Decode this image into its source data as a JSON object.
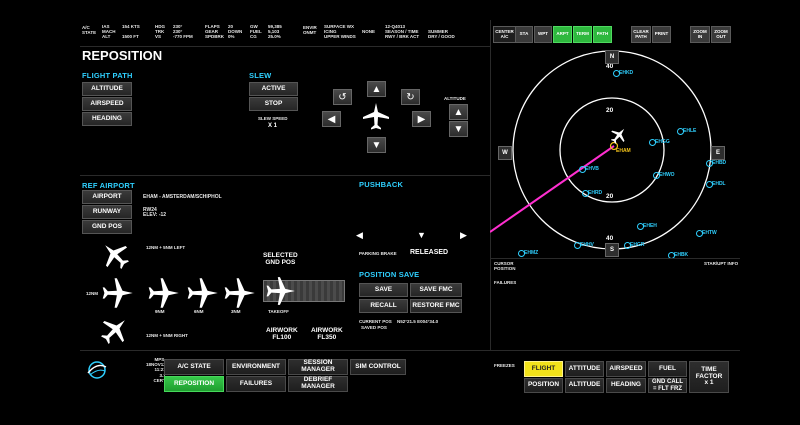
{
  "header": {
    "ac_state": "A/C\nSTATE",
    "c1": {
      "labels": [
        "IAS",
        "MACH",
        "ALT"
      ],
      "values": [
        "154 KTS",
        "",
        "1500 FT"
      ]
    },
    "c2": {
      "labels": [
        "HDG",
        "TRK",
        "VS"
      ],
      "values": [
        "230°",
        "230°",
        "-770 FPM"
      ]
    },
    "c3": {
      "labels": [
        "FLAPS",
        "GEAR",
        "SPDBRK"
      ],
      "values": [
        "20",
        "DOWN",
        "0%"
      ]
    },
    "c4": {
      "labels": [
        "GW",
        "FUEL",
        "CG"
      ],
      "values": [
        "59,385",
        "5,103",
        "25.0%"
      ]
    },
    "envir": "ENVIR\nONMT",
    "c5": {
      "labels": [
        "SURFACE WX",
        "ICING",
        "UPPER WINDS"
      ],
      "values": [
        "",
        "NONE",
        ""
      ]
    },
    "c6": {
      "labels": [
        "12-Q4013",
        "SEASON / TIME",
        "RWY / BRK ACT"
      ],
      "values": [
        "",
        "SUMMER",
        "DRY / GOOD"
      ]
    }
  },
  "page_title": "REPOSITION",
  "flight_path": {
    "title": "FLIGHT PATH",
    "buttons": [
      "ALTITUDE",
      "AIRSPEED",
      "HEADING"
    ]
  },
  "slew": {
    "title": "SLEW",
    "active": "ACTIVE",
    "stop": "STOP",
    "speed_label": "SLEW SPEED",
    "speed_value": "X 1",
    "altitude_label": "ALTITUDE"
  },
  "ref_airport": {
    "title": "REF AIRPORT",
    "buttons": [
      "AIRPORT",
      "RUNWAY",
      "GND POS"
    ],
    "airport_name": "EHAM - AMSTERDAM/SCHIPHOL",
    "runway": "RW24",
    "elev": "ELEV: -12"
  },
  "approach": {
    "left_label": "12NM + 5NM LEFT",
    "right_label": "12NM + 5NM RIGHT",
    "center_label": "12NM",
    "labels": [
      "9NM",
      "6NM",
      "3NM",
      "TAKEOFF"
    ],
    "selected_gnd": "SELECTED\nGND POS",
    "airwork1": "AIRWORK\nFL100",
    "airwork2": "AIRWORK\nFL350"
  },
  "pushback": {
    "title": "PUSHBACK",
    "parking_brake": "PARKING BRAKE",
    "brake_state": "RELEASED"
  },
  "position_save": {
    "title": "POSITION SAVE",
    "save": "SAVE",
    "save_fmc": "SAVE FMC",
    "recall": "RECALL",
    "restore_fmc": "RESTORE FMC",
    "current_pos_label": "CURRENT POS",
    "current_pos_value": "N52°21.5 E004°34.0",
    "saved_pos_label": "SAVED POS"
  },
  "map_toolbar": {
    "center": "CENTER\nA/C",
    "sta": "STA",
    "wpt": "WPT",
    "arpt": "ARPT",
    "term": "TERM",
    "path": "PATH",
    "clear_path": "CLEAR\nPATH",
    "print": "PRINT",
    "zoom_in": "ZOOM\nIN",
    "zoom_out": "ZOOM\nOUT"
  },
  "map": {
    "ring_outer_top": "40",
    "ring_outer_bottom": "40",
    "ring_inner_top": "20",
    "ring_inner_bottom": "20",
    "north": "N",
    "south": "S",
    "west": "W",
    "east": "E",
    "airports": [
      "EHKD",
      "EHLE",
      "EHAM",
      "EHVB",
      "EHGG",
      "EHDL",
      "EHRD",
      "EHWO",
      "EHBD",
      "EHTW",
      "EHGR",
      "EHEH",
      "EHMZ",
      "EHBK",
      "EHHV"
    ],
    "cursor_position": "CURSOR\nPOSITION",
    "starupt_info": "STAR/UPT INFO",
    "failures": "FAILURES"
  },
  "bottom_left": {
    "info": "MPS-\n18NOV12\n11:21\n3.1\nCERT",
    "buttons": [
      "A/C STATE",
      "ENVIRONMENT",
      "SESSION\nMANAGER",
      "SIM CONTROL",
      "REPOSITION",
      "FAILURES",
      "DEBRIEF\nMANAGER"
    ]
  },
  "freezes": {
    "label": "FREEZES",
    "row1": [
      "FLIGHT",
      "ATTITUDE",
      "AIRSPEED",
      "FUEL",
      "TIME\nFACTOR\nx 1"
    ],
    "row2": [
      "POSITION",
      "ALTITUDE",
      "HEADING",
      "GND CALL\n= FLT FRZ"
    ]
  },
  "colors": {
    "accent": "#2fd0ff",
    "active_green": "#2eb83e",
    "freeze_yellow": "#f2e21a",
    "path_magenta": "#ff2fd0"
  }
}
